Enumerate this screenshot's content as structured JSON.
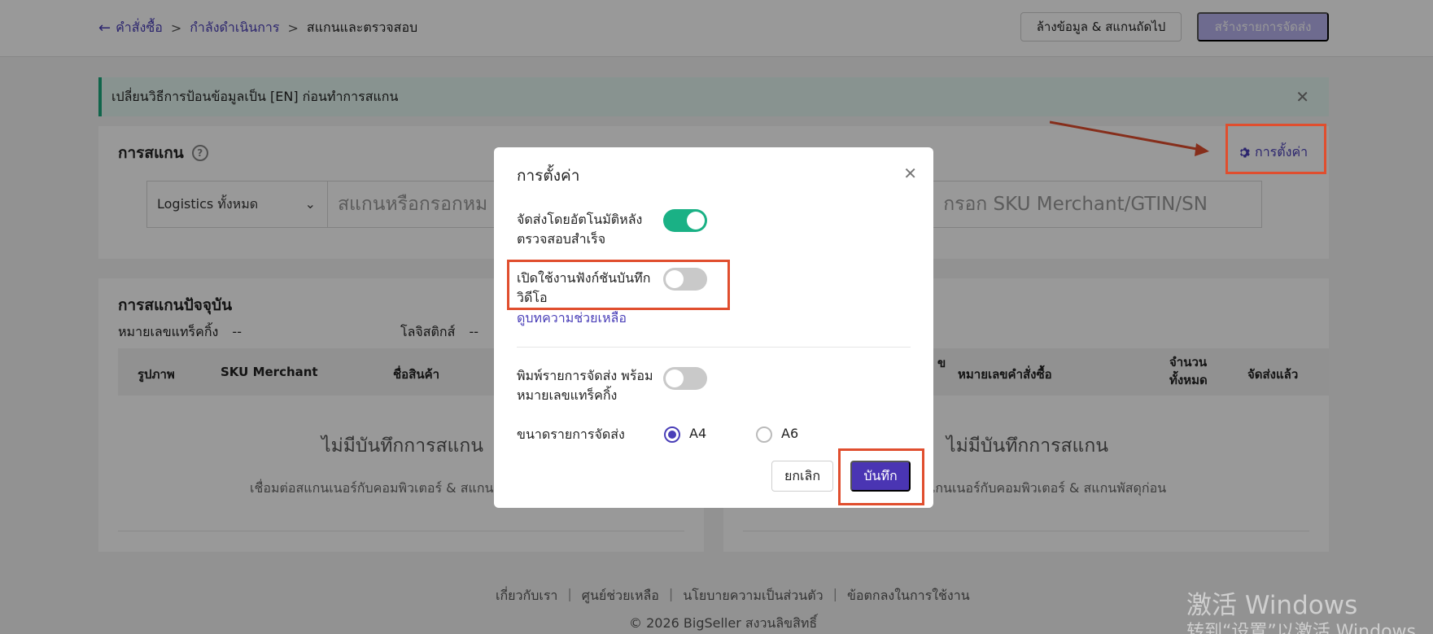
{
  "breadcrumb": {
    "items": [
      "คำสั่งซื้อ",
      "กำลังดำเนินการ",
      "สแกนและตรวจสอบ"
    ],
    "separator": ">"
  },
  "header": {
    "clear_button": "ล้างข้อมูล & สแกนถัดไป",
    "create_button": "สร้างรายการจัดส่ง"
  },
  "notice": {
    "text": "เปลี่ยนวิธีการป้อนข้อมูลเป็น [EN] ก่อนทำการสแกน"
  },
  "scan": {
    "title": "การสแกน",
    "settings_link": "การตั้งค่า",
    "logistics_value": "Logistics ทั้งหมด",
    "placeholder_left": "สแกนหรือกรอกหม",
    "placeholder_right": "กรอก SKU Merchant/GTIN/SN"
  },
  "current_scan": {
    "title": "การสแกนปัจจุบัน",
    "tracking_label": "หมายเลขแทร็คกิ้ง",
    "tracking_value": "--",
    "logistics_label": "โลจิสติกส์",
    "logistics_value": "--",
    "left_columns": [
      "รูปภาพ",
      "SKU Merchant",
      "ชื่อสินค้า"
    ],
    "right_columns": [
      "ข",
      "หมายเลขคำสั่งซื้อ",
      "จำนวน\nทั้งหมด",
      "จัดส่งแล้ว"
    ],
    "empty_title": "ไม่มีบันทึกการสแกน",
    "empty_sub_left": "เชื่อมต่อสแกนเนอร์กับคอมพิวเตอร์ & สแกน",
    "empty_sub_right": "แกนเนอร์กับคอมพิวเตอร์ & สแกนพัสดุก่อน"
  },
  "modal": {
    "title": "การตั้งค่า",
    "opt1_label": "จัดส่งโดยอัตโนมัติหลัง ตรวจสอบสำเร็จ",
    "opt1_on": true,
    "opt2_label": "เปิดใช้งานฟังก์ชันบันทึก วิดีโอ",
    "opt2_on": false,
    "help_link": "ดูบทความช่วยเหลือ",
    "opt3_label": "พิมพ์รายการจัดส่ง พร้อมหมายเลขแทร็คกิ้ง",
    "opt3_on": false,
    "size_label": "ขนาดรายการจัดส่ง",
    "size_options": [
      "A4",
      "A6"
    ],
    "size_selected": "A4",
    "cancel": "ยกเลิก",
    "save": "บันทึก"
  },
  "footer": {
    "links": [
      "เกี่ยวกับเรา",
      "ศูนย์ช่วยเหลือ",
      "นโยบายความเป็นส่วนตัว",
      "ข้อตกลงในการใช้งาน"
    ],
    "copyright": "© 2026 BigSeller สงวนลิขสิทธิ์"
  },
  "watermark": {
    "line1": "激活 Windows",
    "line2": "转到“设置”以激活 Windows"
  },
  "colors": {
    "accent": "#4a35b3",
    "toggle_on": "#1ab185",
    "annotation": "#e04e2e"
  }
}
